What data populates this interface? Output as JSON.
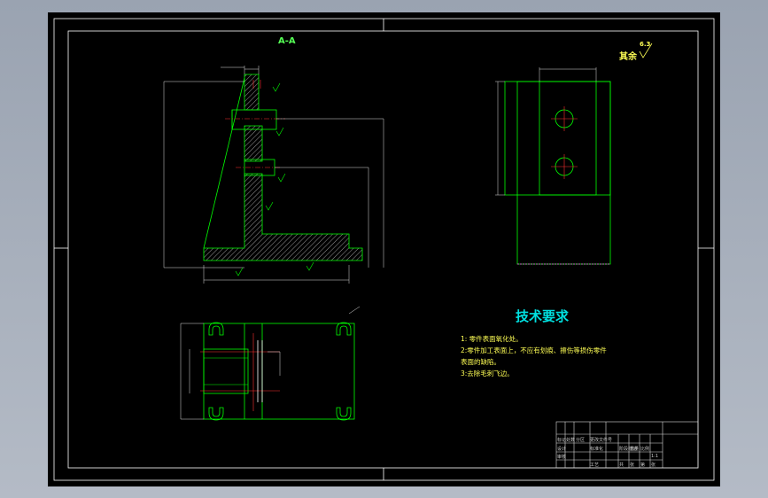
{
  "colors": {
    "background": "#000000",
    "frame": "#ffffff",
    "outline": "#00ff00",
    "hatch": "#ffffff",
    "center_line": "#ff3030",
    "dimension": "#dddddd",
    "notes_text": "#ffff55",
    "notes_title": "#00e0e0",
    "workspace": "#a8b0bc"
  },
  "drawing": {
    "section_label": "A-A",
    "roughness_label": "其余",
    "roughness_value": "6.3"
  },
  "tech_requirements": {
    "title": "技术要求",
    "items": [
      "1: 零件表面氧化处。",
      "2:零件加工表面上，不应有划痕、擦伤等损伤零件",
      "表面的缺陷。",
      "3:去除毛刺飞边。"
    ]
  },
  "title_block": {
    "cells": [
      "标记",
      "处数",
      "分区",
      "更改文件号",
      "签名",
      "年月日",
      "设计",
      "标准化",
      "审核",
      "工艺",
      "批准",
      "阶段标记",
      "重量",
      "比例",
      "共",
      "张",
      "第",
      "张",
      "1:1"
    ]
  }
}
